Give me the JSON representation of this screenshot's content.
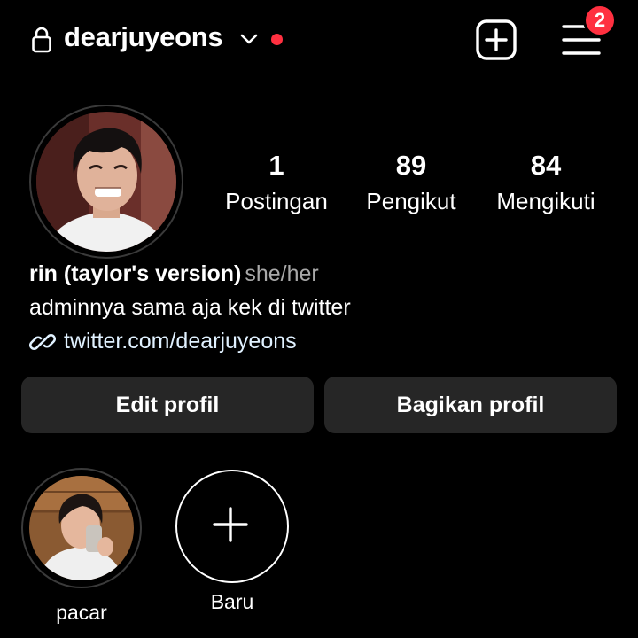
{
  "header": {
    "username": "dearjuyeons",
    "notification_count": "2",
    "icons": [
      "lock-icon",
      "chevron-down-icon",
      "create-post-icon",
      "menu-icon"
    ],
    "live_dot_color": "#ff3040",
    "badge_color": "#ff3040"
  },
  "profile": {
    "stats": [
      {
        "value": "1",
        "label": "Postingan"
      },
      {
        "value": "89",
        "label": "Pengikut"
      },
      {
        "value": "84",
        "label": "Mengikuti"
      }
    ],
    "name": "rin (taylor's version)",
    "pronouns": "she/her",
    "bio": "adminnya sama aja kek di twitter",
    "link": "twitter.com/dearjuyeons",
    "link_color": "#e0f1ff",
    "link_icon": "link-icon"
  },
  "actions": {
    "edit_label": "Edit profil",
    "share_label": "Bagikan profil",
    "button_color": "#262626"
  },
  "highlights": [
    {
      "label": "pacar"
    },
    {
      "label": "Baru",
      "icon": "plus-icon"
    }
  ]
}
